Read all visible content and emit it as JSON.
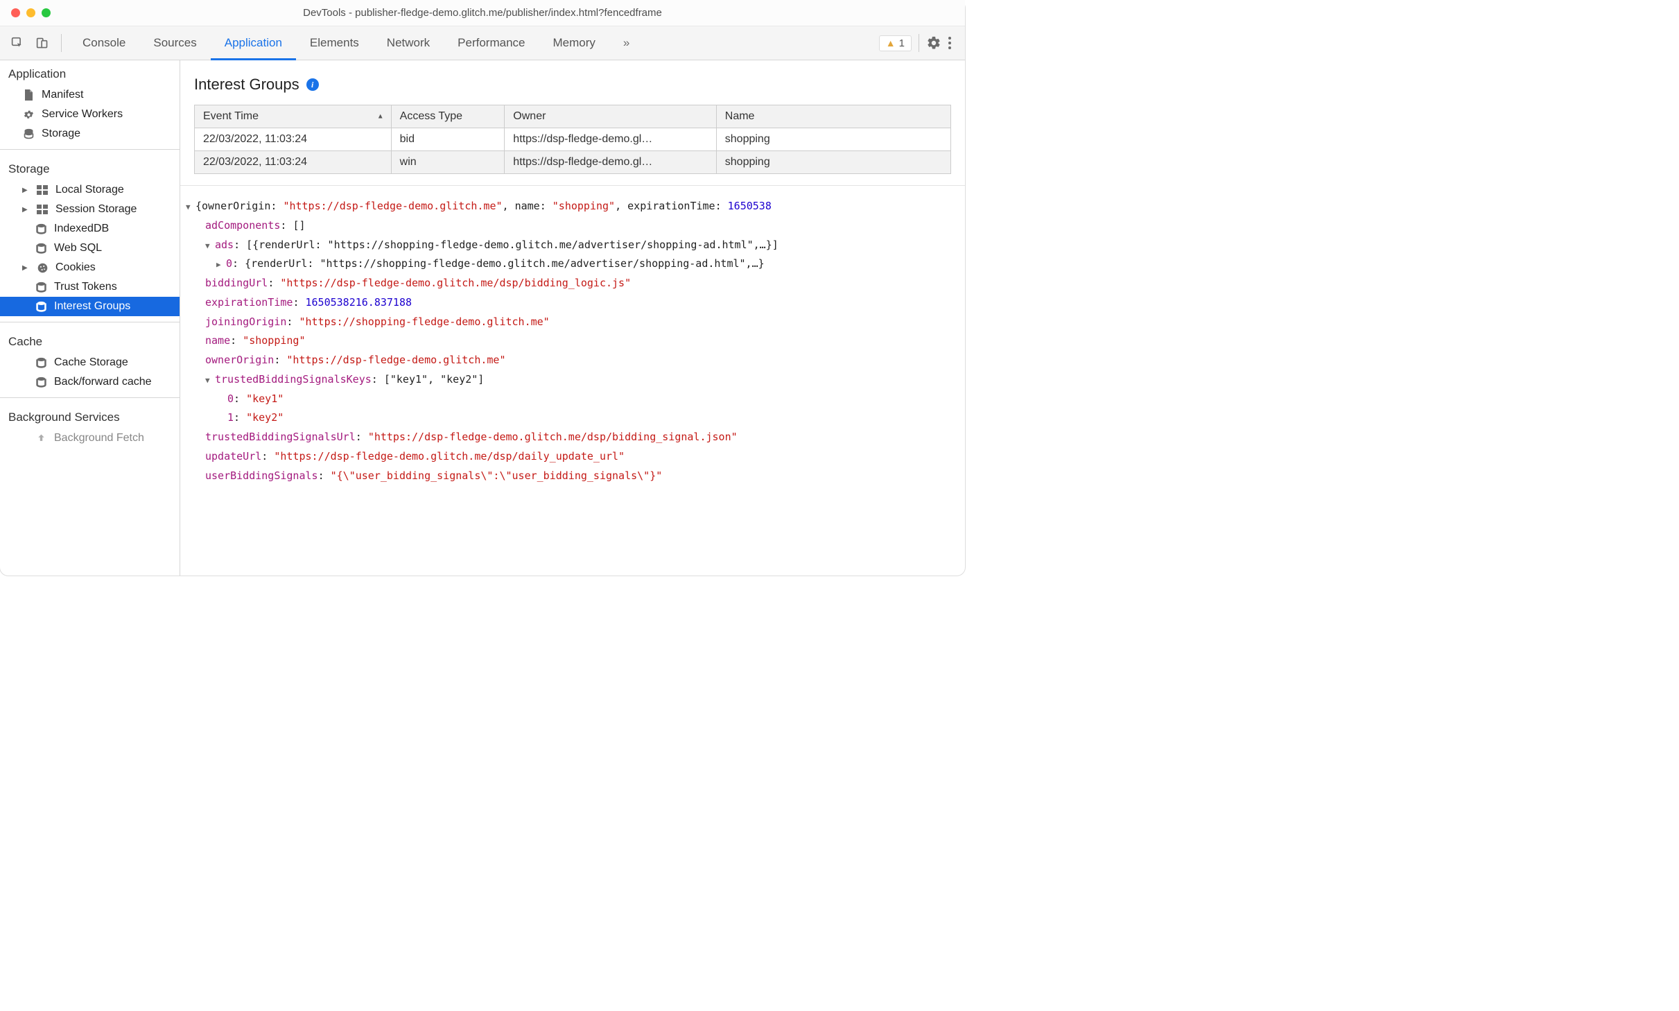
{
  "window": {
    "title": "DevTools - publisher-fledge-demo.glitch.me/publisher/index.html?fencedframe"
  },
  "tabs": [
    "Console",
    "Sources",
    "Application",
    "Elements",
    "Network",
    "Performance",
    "Memory"
  ],
  "active_tab": "Application",
  "more_label": "»",
  "warning_count": "1",
  "sidebar": {
    "s1": {
      "title": "Application",
      "items": [
        {
          "label": "Manifest"
        },
        {
          "label": "Service Workers"
        },
        {
          "label": "Storage"
        }
      ]
    },
    "s2": {
      "title": "Storage",
      "items": [
        {
          "label": "Local Storage",
          "expandable": true
        },
        {
          "label": "Session Storage",
          "expandable": true
        },
        {
          "label": "IndexedDB"
        },
        {
          "label": "Web SQL"
        },
        {
          "label": "Cookies",
          "expandable": true
        },
        {
          "label": "Trust Tokens"
        },
        {
          "label": "Interest Groups",
          "selected": true
        }
      ]
    },
    "s3": {
      "title": "Cache",
      "items": [
        {
          "label": "Cache Storage"
        },
        {
          "label": "Back/forward cache"
        }
      ]
    },
    "s4": {
      "title": "Background Services",
      "items": [
        {
          "label": "Background Fetch"
        }
      ]
    }
  },
  "panel": {
    "title": "Interest Groups"
  },
  "table": {
    "headers": [
      "Event Time",
      "Access Type",
      "Owner",
      "Name"
    ],
    "sort_col": 0,
    "rows": [
      {
        "time": "22/03/2022, 11:03:24",
        "type": "bid",
        "owner": "https://dsp-fledge-demo.gl…",
        "name": "shopping"
      },
      {
        "time": "22/03/2022, 11:03:24",
        "type": "win",
        "owner": "https://dsp-fledge-demo.gl…",
        "name": "shopping"
      }
    ]
  },
  "detail": {
    "summary_prefix": "{ownerOrigin: ",
    "summary_owner": "\"https://dsp-fledge-demo.glitch.me\"",
    "summary_mid1": ", name: ",
    "summary_name": "\"shopping\"",
    "summary_mid2": ", expirationTime: ",
    "summary_exp": "1650538",
    "adComponents": {
      "key": "adComponents",
      "preview": "[]"
    },
    "ads": {
      "key": "ads",
      "preview": "[{renderUrl: \"https://shopping-fledge-demo.glitch.me/advertiser/shopping-ad.html\",…}]",
      "child_key": "0",
      "child_preview": "{renderUrl: \"https://shopping-fledge-demo.glitch.me/advertiser/shopping-ad.html\",…}"
    },
    "biddingUrl": {
      "key": "biddingUrl",
      "val": "\"https://dsp-fledge-demo.glitch.me/dsp/bidding_logic.js\""
    },
    "expirationTime": {
      "key": "expirationTime",
      "val": "1650538216.837188"
    },
    "joiningOrigin": {
      "key": "joiningOrigin",
      "val": "\"https://shopping-fledge-demo.glitch.me\""
    },
    "name": {
      "key": "name",
      "val": "\"shopping\""
    },
    "ownerOrigin": {
      "key": "ownerOrigin",
      "val": "\"https://dsp-fledge-demo.glitch.me\""
    },
    "tbsk": {
      "key": "trustedBiddingSignalsKeys",
      "preview": "[\"key1\", \"key2\"]",
      "k0": "0",
      "v0": "\"key1\"",
      "k1": "1",
      "v1": "\"key2\""
    },
    "tbsu": {
      "key": "trustedBiddingSignalsUrl",
      "val": "\"https://dsp-fledge-demo.glitch.me/dsp/bidding_signal.json\""
    },
    "updateUrl": {
      "key": "updateUrl",
      "val": "\"https://dsp-fledge-demo.glitch.me/dsp/daily_update_url\""
    },
    "userBiddingSignals": {
      "key": "userBiddingSignals",
      "val": "\"{\\\"user_bidding_signals\\\":\\\"user_bidding_signals\\\"}\""
    }
  }
}
